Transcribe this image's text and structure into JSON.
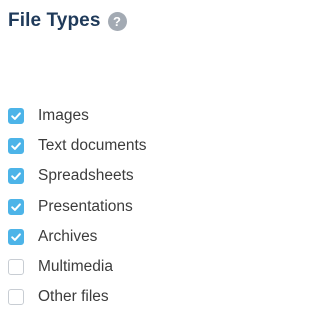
{
  "panel": {
    "title": "File Types",
    "help_icon_glyph": "?",
    "help_icon": "question-circle-icon"
  },
  "colors": {
    "title": "#1f3a5a",
    "checkbox_checked": "#4db4e8",
    "checkbox_unchecked_border": "#c8cdd3",
    "help_icon_bg": "#a3aab3",
    "label_text": "#3c3c3c"
  },
  "file_types": [
    {
      "label": "Images",
      "checked": true,
      "id": "images"
    },
    {
      "label": "Text documents",
      "checked": true,
      "id": "text-documents"
    },
    {
      "label": "Spreadsheets",
      "checked": true,
      "id": "spreadsheets"
    },
    {
      "label": "Presentations",
      "checked": true,
      "id": "presentations"
    },
    {
      "label": "Archives",
      "checked": true,
      "id": "archives"
    },
    {
      "label": "Multimedia",
      "checked": false,
      "id": "multimedia"
    },
    {
      "label": "Other files",
      "checked": false,
      "id": "other-files"
    }
  ]
}
